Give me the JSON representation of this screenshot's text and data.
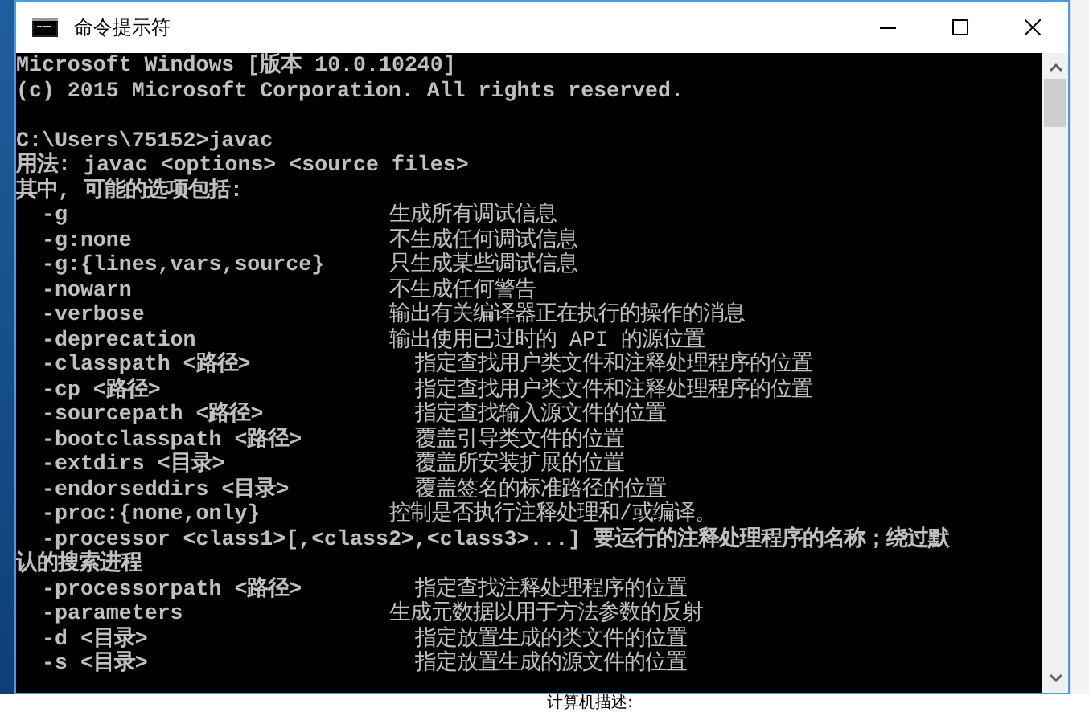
{
  "window": {
    "title": "命令提示符"
  },
  "console": {
    "lines": [
      {
        "kind": "text",
        "text": "Microsoft Windows [版本 10.0.10240]"
      },
      {
        "kind": "text",
        "text": "(c) 2015 Microsoft Corporation. All rights reserved."
      },
      {
        "kind": "blank"
      },
      {
        "kind": "text",
        "text": "C:\\Users\\75152>javac"
      },
      {
        "kind": "text",
        "text": "用法: javac <options> <source files>"
      },
      {
        "kind": "text",
        "text": "其中, 可能的选项包括:"
      },
      {
        "kind": "option",
        "option": "-g",
        "description": "生成所有调试信息"
      },
      {
        "kind": "option",
        "option": "-g:none",
        "description": "不生成任何调试信息"
      },
      {
        "kind": "option",
        "option": "-g:{lines,vars,source}",
        "description": "只生成某些调试信息"
      },
      {
        "kind": "option",
        "option": "-nowarn",
        "description": "不生成任何警告"
      },
      {
        "kind": "option",
        "option": "-verbose",
        "description": "输出有关编译器正在执行的操作的消息"
      },
      {
        "kind": "option",
        "option": "-deprecation",
        "description": "输出使用已过时的 API 的源位置"
      },
      {
        "kind": "option",
        "option": "-classpath <路径>",
        "description": "指定查找用户类文件和注释处理程序的位置"
      },
      {
        "kind": "option",
        "option": "-cp <路径>",
        "description": "指定查找用户类文件和注释处理程序的位置"
      },
      {
        "kind": "option",
        "option": "-sourcepath <路径>",
        "description": "指定查找输入源文件的位置"
      },
      {
        "kind": "option",
        "option": "-bootclasspath <路径>",
        "description": "覆盖引导类文件的位置"
      },
      {
        "kind": "option",
        "option": "-extdirs <目录>",
        "description": "覆盖所安装扩展的位置"
      },
      {
        "kind": "option",
        "option": "-endorseddirs <目录>",
        "description": "覆盖签名的标准路径的位置"
      },
      {
        "kind": "option",
        "option": "-proc:{none,only}",
        "description": "控制是否执行注释处理和/或编译。"
      },
      {
        "kind": "indented",
        "text": "-processor <class1>[,<class2>,<class3>...] 要运行的注释处理程序的名称；绕过默"
      },
      {
        "kind": "text",
        "text": "认的搜索进程"
      },
      {
        "kind": "option",
        "option": "-processorpath <路径>",
        "description": "指定查找注释处理程序的位置"
      },
      {
        "kind": "option",
        "option": "-parameters",
        "description": "生成元数据以用于方法参数的反射"
      },
      {
        "kind": "option",
        "option": "-d <目录>",
        "description": "指定放置生成的类文件的位置"
      },
      {
        "kind": "option",
        "option": "-s <目录>",
        "description": "指定放置生成的源文件的位置"
      }
    ]
  },
  "background": {
    "text": "计算机描述:"
  }
}
